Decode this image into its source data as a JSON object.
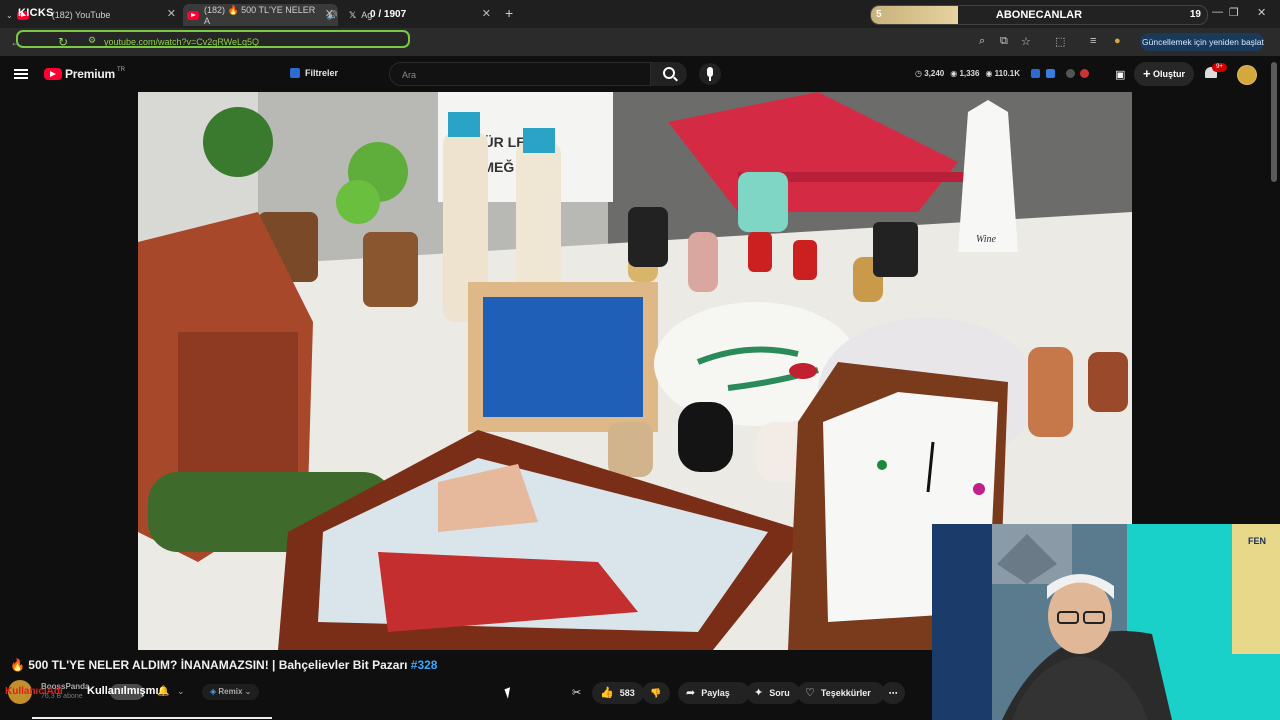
{
  "browser": {
    "tabs": [
      {
        "label": "(182) YouTube"
      },
      {
        "label": "(182) 🔥 500 TL'YE NELER A"
      },
      {
        "label": "Ag"
      }
    ],
    "overlay_left": "KICKS",
    "overlay_counter": "0 / 1907",
    "subscriber_goal": {
      "left_value": "5",
      "label": "ABONECANLAR",
      "right_value": "19",
      "progress": 0.26
    },
    "url": "youtube.com/watch?v=Cv2qRWeLq5Q",
    "update_button": "Güncellemek için yeniden başlat"
  },
  "youtube": {
    "logo_text": "Premium",
    "region": "TR",
    "filters_label": "Filtreler",
    "search_placeholder": "Ara",
    "stats": [
      "3,240",
      "1,336",
      "110.1K"
    ],
    "create_label": "Oluştur",
    "notification_badge": "9+"
  },
  "video": {
    "title_prefix": "🔥 500 TL'YE NELER ALDIM? İNANAMAZSIN! | Bahçelievler Bit Pazarı ",
    "title_tag": "#328",
    "sign_text": "M ÜR   LER\n EMEĞ  DİR",
    "bottle_text": "Wine\nthe\ntherapy"
  },
  "channel": {
    "name": "BoossPanda",
    "subscribers": "76,3 B abone",
    "overlay_red": "KullanıcıAdı",
    "overlay_white": "Kullanılmışmı"
  },
  "actions": {
    "remix": "Remix",
    "likes": "583",
    "share": "Paylaş",
    "ask": "Soru",
    "thanks": "Teşekkürler",
    "more": "⋯"
  },
  "colors": {
    "accent": "#ff0033",
    "link": "#3ea6ff",
    "progress": "#7ac943"
  }
}
